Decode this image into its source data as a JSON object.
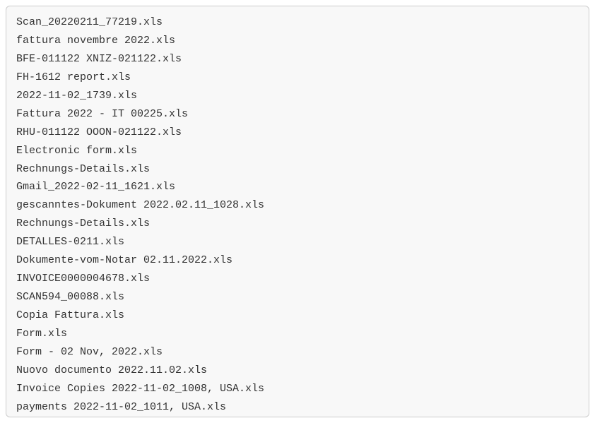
{
  "files": [
    "Scan_20220211_77219.xls",
    "fattura novembre 2022.xls",
    "BFE-011122 XNIZ-021122.xls",
    "FH-1612 report.xls",
    "2022-11-02_1739.xls",
    "Fattura 2022 - IT 00225.xls",
    "RHU-011122 OOON-021122.xls",
    "Electronic form.xls",
    "Rechnungs-Details.xls",
    "Gmail_2022-02-11_1621.xls",
    "gescanntes-Dokument 2022.02.11_1028.xls",
    "Rechnungs-Details.xls",
    "DETALLES-0211.xls",
    "Dokumente-vom-Notar 02.11.2022.xls",
    "INVOICE0000004678.xls",
    "SCAN594_00088.xls",
    "Copia Fattura.xls",
    "Form.xls",
    "Form - 02 Nov, 2022.xls",
    "Nuovo documento 2022.11.02.xls",
    "Invoice Copies 2022-11-02_1008, USA.xls",
    "payments 2022-11-02_1011, USA.xls"
  ]
}
